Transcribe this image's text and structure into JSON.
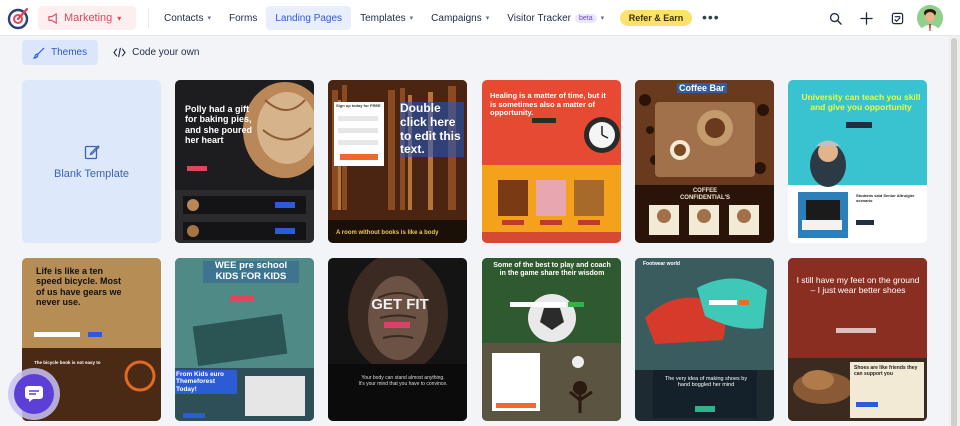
{
  "header": {
    "app_switch": "Marketing",
    "nav": [
      {
        "label": "Contacts",
        "dropdown": true
      },
      {
        "label": "Forms",
        "dropdown": false
      },
      {
        "label": "Landing Pages",
        "dropdown": false,
        "active": true
      },
      {
        "label": "Templates",
        "dropdown": true
      },
      {
        "label": "Campaigns",
        "dropdown": true
      }
    ],
    "visitor_tracker": "Visitor Tracker",
    "beta": "beta",
    "refer": "Refer & Earn",
    "more": "•••"
  },
  "tabs": {
    "themes": "Themes",
    "code": "Code your own"
  },
  "blank_template": "Blank Template",
  "templates": {
    "t1": "Polly had a gift for baking pies, and she poured her heart",
    "t2_title": "Double click here to edit this text.",
    "t2_form": "Sign up today for FREE",
    "t2_footer": "A room without books is like a body",
    "t3_title": "Healing is a matter of time, but it is sometimes also a matter of opportunity.",
    "t4_title": "Coffee Bar",
    "t4_sub": "COFFEE CONFIDENTIAL'S",
    "t5_title": "University can teach you skill and give you opportunity",
    "t5_sub": "Students said Senior Altruigler scenario",
    "t6_title": "Life is like a ten speed bicycle. Most of us have gears we never use.",
    "t6_sub": "The bicycle book is not easy to",
    "t7_title": "WEE pre school KIDS FOR KIDS",
    "t7_sub": "From Kids euro Themeforest Today!",
    "t8_title": "GET FIT",
    "t8_sub": "Your body can stand almost anything. It's your mind that you have to convince.",
    "t9_title": "Some of the best to play and coach in the game share their wisdom",
    "t10_brand": "Footwear world",
    "t10_sub": "The very idea of making shoes by hand boggled her mind",
    "t11_title": "I still have my feet on the ground – I just wear better shoes",
    "t11_sub": "Shoes are like friends they can support you"
  },
  "colors": {
    "accent": "#2c5bd6",
    "brand_red": "#e0465a",
    "chat": "#5b3fd6",
    "refer": "#fbe36b"
  }
}
